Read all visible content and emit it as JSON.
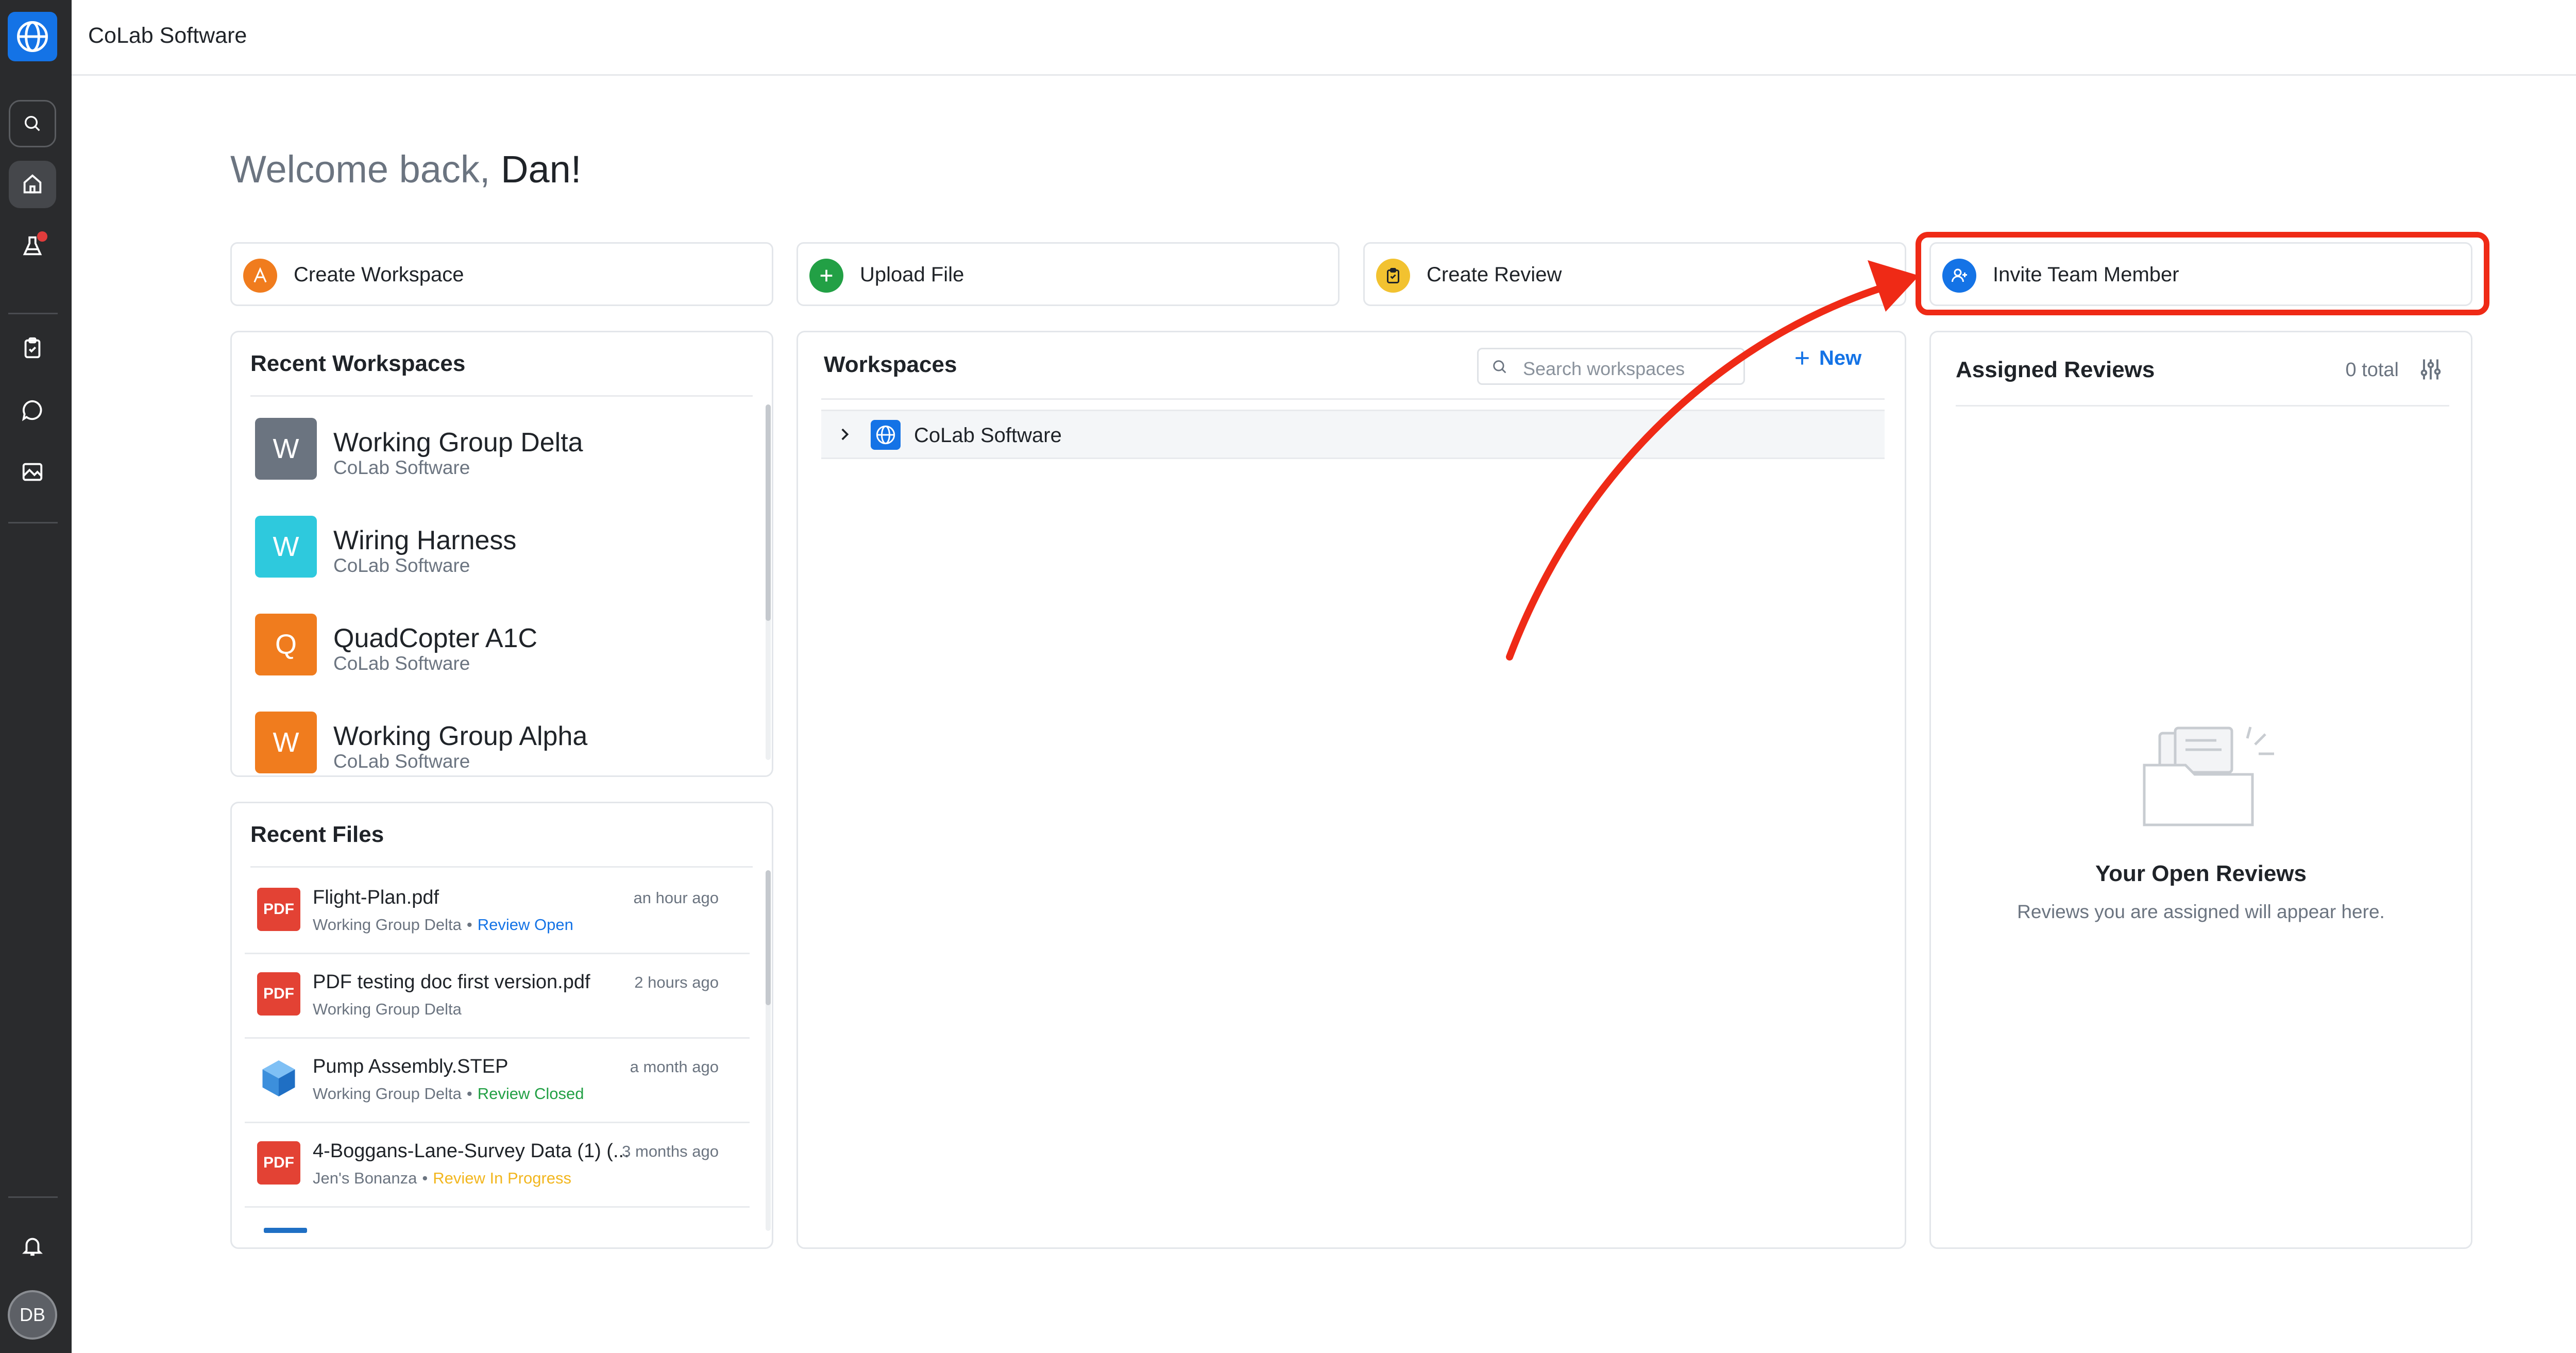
{
  "app": {
    "title": "CoLab Software"
  },
  "user": {
    "initials": "DB"
  },
  "welcome": {
    "prefix": "Welcome back,",
    "name": "Dan!"
  },
  "actions": [
    {
      "label": "Create Workspace",
      "icon": "workspace-icon",
      "color": "#f07c1e"
    },
    {
      "label": "Upload File",
      "icon": "plus-icon",
      "color": "#22a045"
    },
    {
      "label": "Create Review",
      "icon": "clipboard-icon",
      "color": "#f2c230"
    },
    {
      "label": "Invite Team Member",
      "icon": "add-user-icon",
      "color": "#1473e6"
    }
  ],
  "recent_workspaces": {
    "title": "Recent Workspaces",
    "items": [
      {
        "initial": "W",
        "name": "Working Group Delta",
        "org": "CoLab Software",
        "color": "#6b7480"
      },
      {
        "initial": "W",
        "name": "Wiring Harness",
        "org": "CoLab Software",
        "color": "#2ec9dd"
      },
      {
        "initial": "Q",
        "name": "QuadCopter A1C",
        "org": "CoLab Software",
        "color": "#f07c1e"
      },
      {
        "initial": "W",
        "name": "Working Group Alpha",
        "org": "CoLab Software",
        "color": "#f07c1e"
      }
    ]
  },
  "recent_files": {
    "title": "Recent Files",
    "items": [
      {
        "icon": "PDF",
        "name": "Flight-Plan.pdf",
        "workspace": "Working Group Delta",
        "status": "Review Open",
        "status_color": "#1473e6",
        "time": "an hour ago"
      },
      {
        "icon": "PDF",
        "name": "PDF testing doc first version.pdf",
        "workspace": "Working Group Delta",
        "status": "",
        "status_color": "",
        "time": "2 hours ago"
      },
      {
        "icon": "cube",
        "name": "Pump Assembly.STEP",
        "workspace": "Working Group Delta",
        "status": "Review Closed",
        "status_color": "#22a045",
        "time": "a month ago"
      },
      {
        "icon": "PDF",
        "name": "4-Boggans-Lane-Survey Data (1) (...",
        "workspace": "Jen's Bonanza",
        "status": "Review In Progress",
        "status_color": "#f2b61e",
        "time": "3 months ago"
      }
    ]
  },
  "workspaces": {
    "title": "Workspaces",
    "search_placeholder": "Search workspaces",
    "new_label": "New",
    "tree": [
      {
        "name": "CoLab Software"
      }
    ]
  },
  "assigned_reviews": {
    "title": "Assigned Reviews",
    "count": "0 total",
    "empty_title": "Your Open Reviews",
    "empty_subtitle": "Reviews you are assigned will appear here."
  },
  "colors": {
    "brand": "#1473e6",
    "rail": "#2a2b2d",
    "annotation": "#ef2a16"
  }
}
